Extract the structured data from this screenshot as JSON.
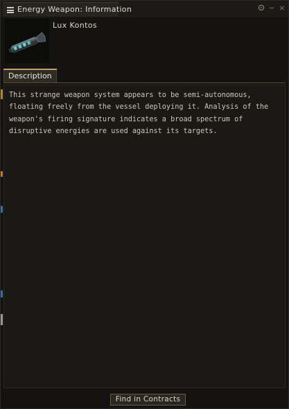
{
  "window": {
    "title": "Energy Weapon: Information",
    "controls": {
      "settings_icon": "gear-icon",
      "minimize_symbol": "−",
      "close_symbol": "×"
    },
    "collapse_symbol": "«»"
  },
  "item": {
    "name": "Lux Kontos",
    "icon": "energy-weapon-drone-icon"
  },
  "tabs": [
    {
      "label": "Description",
      "active": true
    }
  ],
  "description": "This strange weapon system appears to be semi-autonomous, floating freely from the vessel deploying it. Analysis of the weapon's firing signature indicates a broad spectrum of disruptive energies are used against its targets.",
  "footer": {
    "find_in_contracts_label": "Find in Contracts"
  },
  "colors": {
    "accent_gold": "#bfa26c",
    "button_border": "#6a5a3f",
    "window_bg": "#141311"
  }
}
